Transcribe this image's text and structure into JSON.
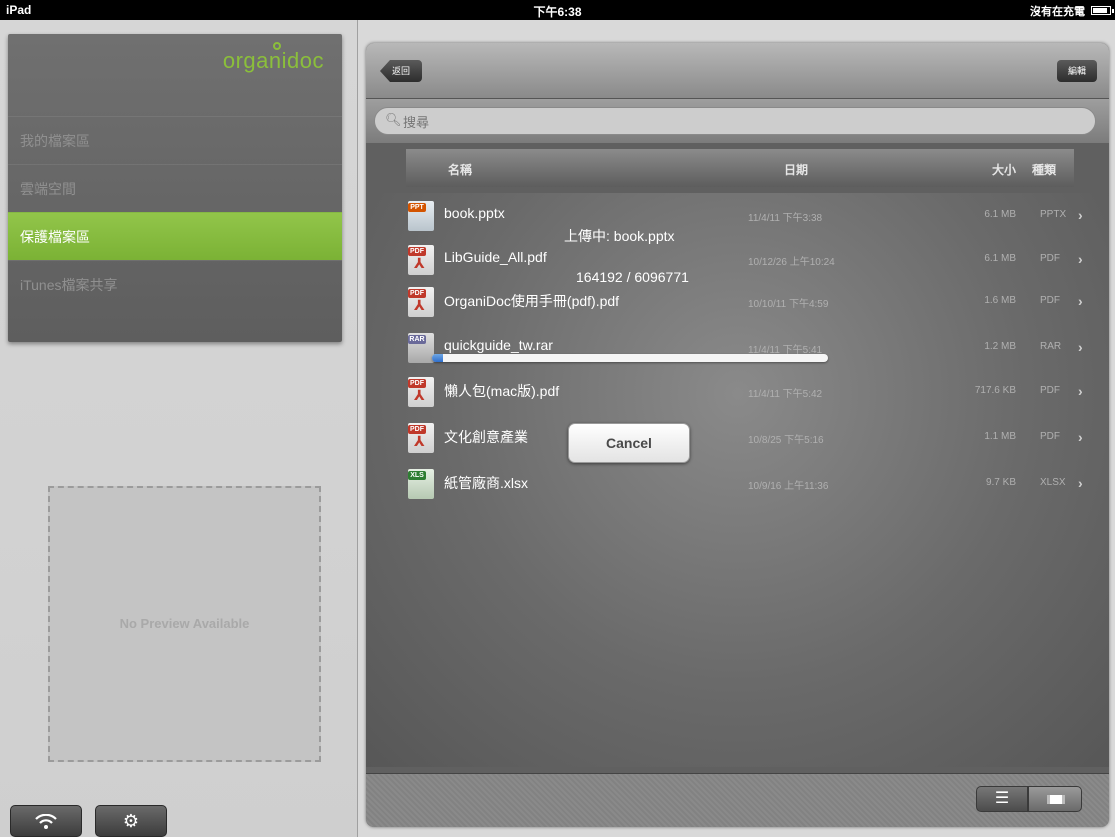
{
  "status_bar": {
    "device": "iPad",
    "time": "下午6:38",
    "charging": "沒有在充電"
  },
  "sidebar": {
    "logo": "organidoc",
    "items": [
      {
        "label": "我的檔案區"
      },
      {
        "label": "雲端空間"
      },
      {
        "label": "保護檔案區"
      },
      {
        "label": "iTunes檔案共享"
      }
    ],
    "active_index": 2,
    "preview_text": "No Preview Available"
  },
  "toolbar": {
    "back_label": "返回",
    "edit_label": "編輯"
  },
  "search": {
    "placeholder": "搜尋"
  },
  "table": {
    "headers": {
      "name": "名稱",
      "date": "日期",
      "size": "大小",
      "type": "種類"
    },
    "rows": [
      {
        "name": "book.pptx",
        "date": "11/4/11 下午3:38",
        "size": "6.1 MB",
        "type": "PPTX",
        "icon": "pptx-icon"
      },
      {
        "name": "LibGuide_All.pdf",
        "date": "10/12/26 上午10:24",
        "size": "6.1 MB",
        "type": "PDF",
        "icon": "pdf-icon"
      },
      {
        "name": "OrganiDoc使用手冊(pdf).pdf",
        "date": "10/10/11 下午4:59",
        "size": "1.6 MB",
        "type": "PDF",
        "icon": "pdf-icon"
      },
      {
        "name": "quickguide_tw.rar",
        "date": "11/4/11 下午5:41",
        "size": "1.2 MB",
        "type": "RAR",
        "icon": "rar-icon"
      },
      {
        "name": "懶人包(mac版).pdf",
        "date": "11/4/11 下午5:42",
        "size": "717.6 KB",
        "type": "PDF",
        "icon": "pdf-icon"
      },
      {
        "name": "文化創意產業",
        "date": "10/8/25 下午5:16",
        "size": "1.1 MB",
        "type": "PDF",
        "icon": "pdf-icon"
      },
      {
        "name": "紙管廠商.xlsx",
        "date": "10/9/16 上午11:36",
        "size": "9.7 KB",
        "type": "XLSX",
        "icon": "xlsx-icon"
      }
    ]
  },
  "upload": {
    "title": "上傳中: book.pptx",
    "progress_text": "164192 / 6096771",
    "progress_fraction": 0.027,
    "cancel_label": "Cancel"
  },
  "bottom_bar": {
    "list_view_icon": "list-icon",
    "grid_view_icon": "grid-icon"
  }
}
